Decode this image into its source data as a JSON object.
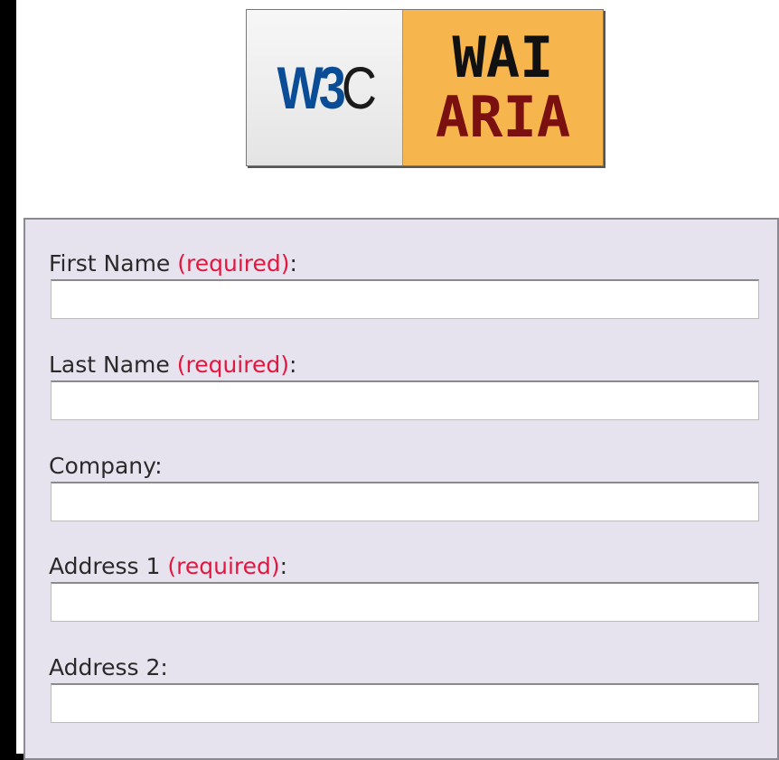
{
  "logo": {
    "w3c_text_main": "W3",
    "w3c_text_c": "C",
    "line1": "WAI",
    "line2": "ARIA"
  },
  "form": {
    "fields": [
      {
        "label": "First Name",
        "required_text": "(required)",
        "suffix": ":",
        "value": "",
        "placeholder": ""
      },
      {
        "label": "Last Name",
        "required_text": "(required)",
        "suffix": ":",
        "value": "",
        "placeholder": ""
      },
      {
        "label": "Company",
        "required_text": "",
        "suffix": ":",
        "value": "",
        "placeholder": ""
      },
      {
        "label": "Address 1",
        "required_text": "(required)",
        "suffix": ":",
        "value": "",
        "placeholder": ""
      },
      {
        "label": "Address 2",
        "required_text": "",
        "suffix": ":",
        "value": "",
        "placeholder": ""
      }
    ]
  },
  "colors": {
    "required": "#e3163f",
    "panel_background": "#e7e3ee",
    "logo_w3c_blue": "#0a4d96",
    "logo_aria_background": "#f7b54d",
    "logo_aria_text": "#7a1010"
  }
}
